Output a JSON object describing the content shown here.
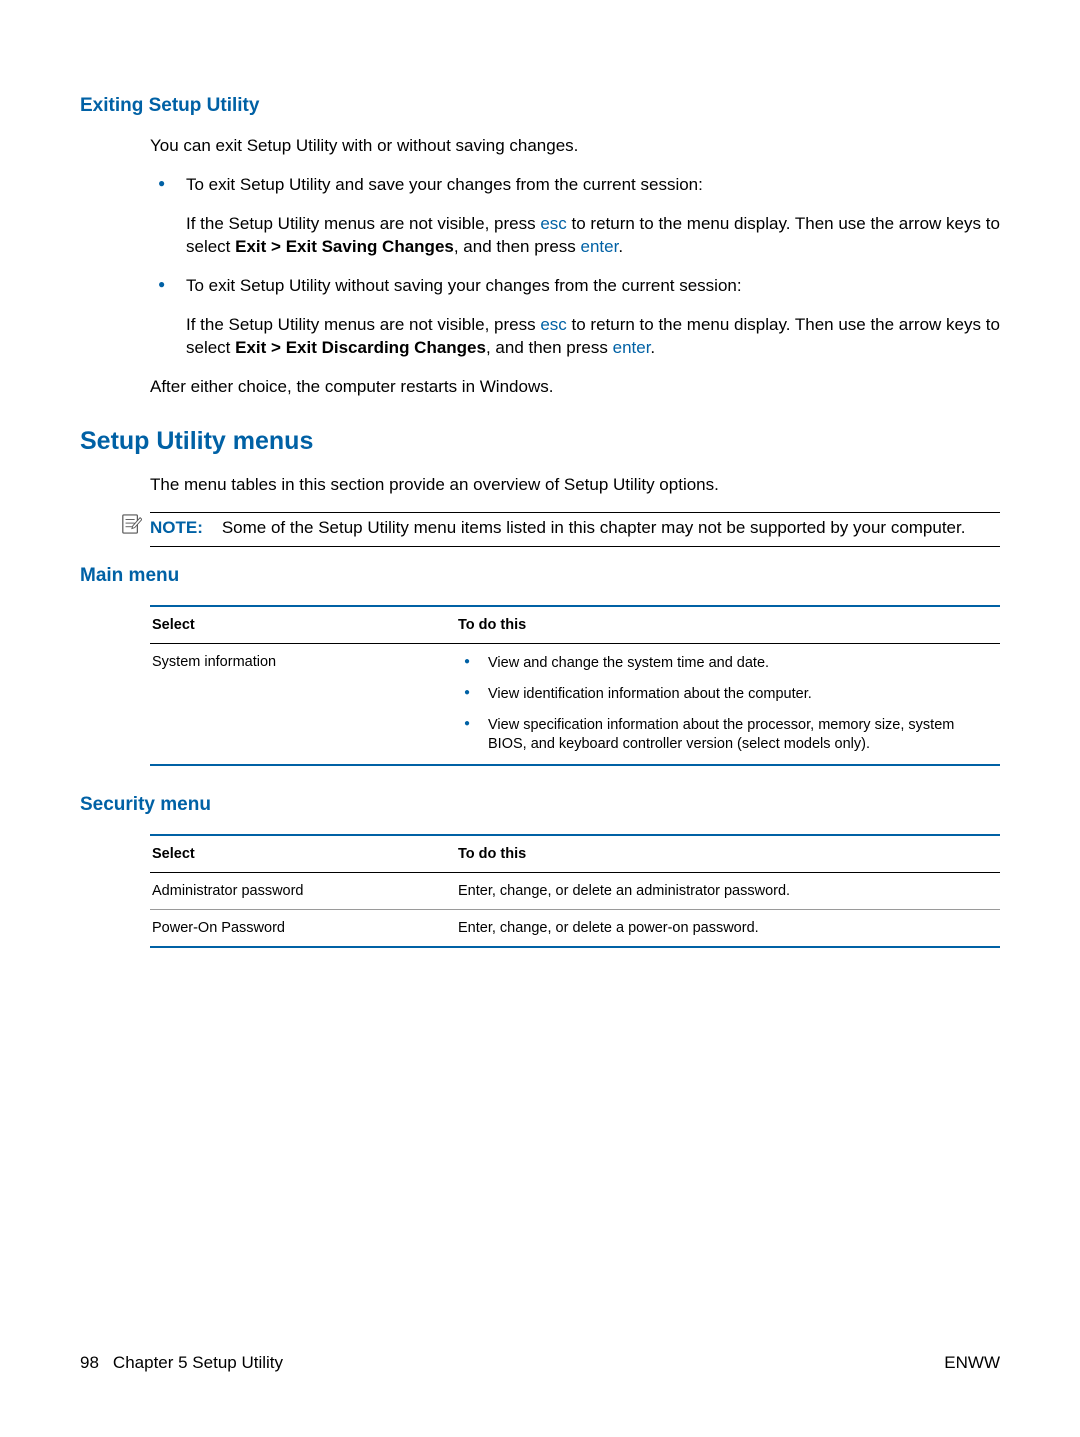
{
  "headings": {
    "exiting": "Exiting Setup Utility",
    "menus": "Setup Utility menus",
    "main": "Main menu",
    "security": "Security menu"
  },
  "exiting": {
    "intro": "You can exit Setup Utility with or without saving changes.",
    "b1_lead": "To exit Setup Utility and save your changes from the current session:",
    "b1_p_a": "If the Setup Utility menus are not visible, press ",
    "b1_key1": "esc",
    "b1_p_b": " to return to the menu display. Then use the arrow keys to select ",
    "b1_bold": "Exit > Exit Saving Changes",
    "b1_p_c": ", and then press ",
    "b1_key2": "enter",
    "b1_p_d": ".",
    "b2_lead": "To exit Setup Utility without saving your changes from the current session:",
    "b2_p_a": "If the Setup Utility menus are not visible, press ",
    "b2_key1": "esc",
    "b2_p_b": " to return to the menu display. Then use the arrow keys to select ",
    "b2_bold": "Exit > Exit Discarding Changes",
    "b2_p_c": ", and then press ",
    "b2_key2": "enter",
    "b2_p_d": ".",
    "after": "After either choice, the computer restarts in Windows."
  },
  "menus": {
    "intro": "The menu tables in this section provide an overview of Setup Utility options.",
    "note_label": "NOTE:",
    "note_text": "Some of the Setup Utility menu items listed in this chapter may not be supported by your computer."
  },
  "table_headers": {
    "select": "Select",
    "todo": "To do this"
  },
  "main_table": {
    "r1_select": "System information",
    "r1_items": [
      "View and change the system time and date.",
      "View identification information about the computer.",
      "View specification information about the processor, memory size, system BIOS, and keyboard controller version (select models only)."
    ]
  },
  "security_table": {
    "r1_select": "Administrator password",
    "r1_do": "Enter, change, or delete an administrator password.",
    "r2_select": "Power-On Password",
    "r2_do": "Enter, change, or delete a power-on password."
  },
  "footer": {
    "page": "98",
    "chapter": "Chapter 5   Setup Utility",
    "right": "ENWW"
  }
}
